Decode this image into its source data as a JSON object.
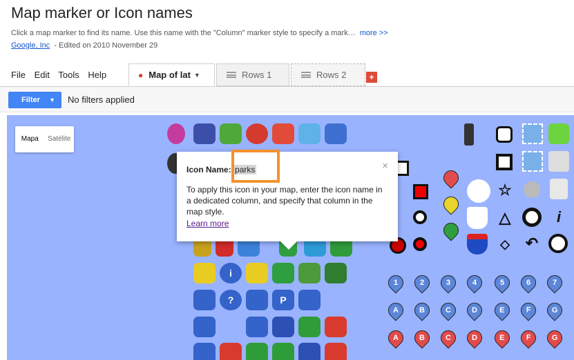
{
  "header": {
    "title": "Map marker or Icon names",
    "description": "Click a map marker to find its name. Use this name with the \"Column\" marker style to specify a mark…",
    "more_link": "more >>",
    "owner": "Google, Inc",
    "edited": "- Edited on 2010 November 29"
  },
  "menu": {
    "file": "File",
    "edit": "Edit",
    "tools": "Tools",
    "help": "Help"
  },
  "tabs": {
    "map": "Map of lat",
    "rows1": "Rows 1",
    "rows2": "Rows 2",
    "add": "+"
  },
  "filter": {
    "button": "Filter",
    "status": "No filters applied"
  },
  "map": {
    "type_map": "Mapa",
    "type_satellite": "Satélite",
    "numbered_pins": [
      "1",
      "2",
      "3",
      "4",
      "5",
      "6",
      "7"
    ],
    "lettered_pins_blue": [
      "A",
      "B",
      "C",
      "D",
      "E",
      "F",
      "G"
    ],
    "lettered_pins_red": [
      "A",
      "B",
      "C",
      "D",
      "E",
      "F",
      "G"
    ],
    "info_pin": "i",
    "question_icon": "?",
    "parking_icon": "P"
  },
  "popup": {
    "label": "Icon Name",
    "colon": ":",
    "value": "parks",
    "close": "×",
    "body": "To apply this icon in your map, enter the icon name in a dedicated column, and specify that column in the map style.",
    "learn_more": "Learn more"
  },
  "colors": {
    "accent": "#4285f4",
    "map_bg": "#99b3ff",
    "highlight": "#f4922c",
    "pin_blue": "#5c86d8",
    "pin_red": "#e24b4b"
  }
}
